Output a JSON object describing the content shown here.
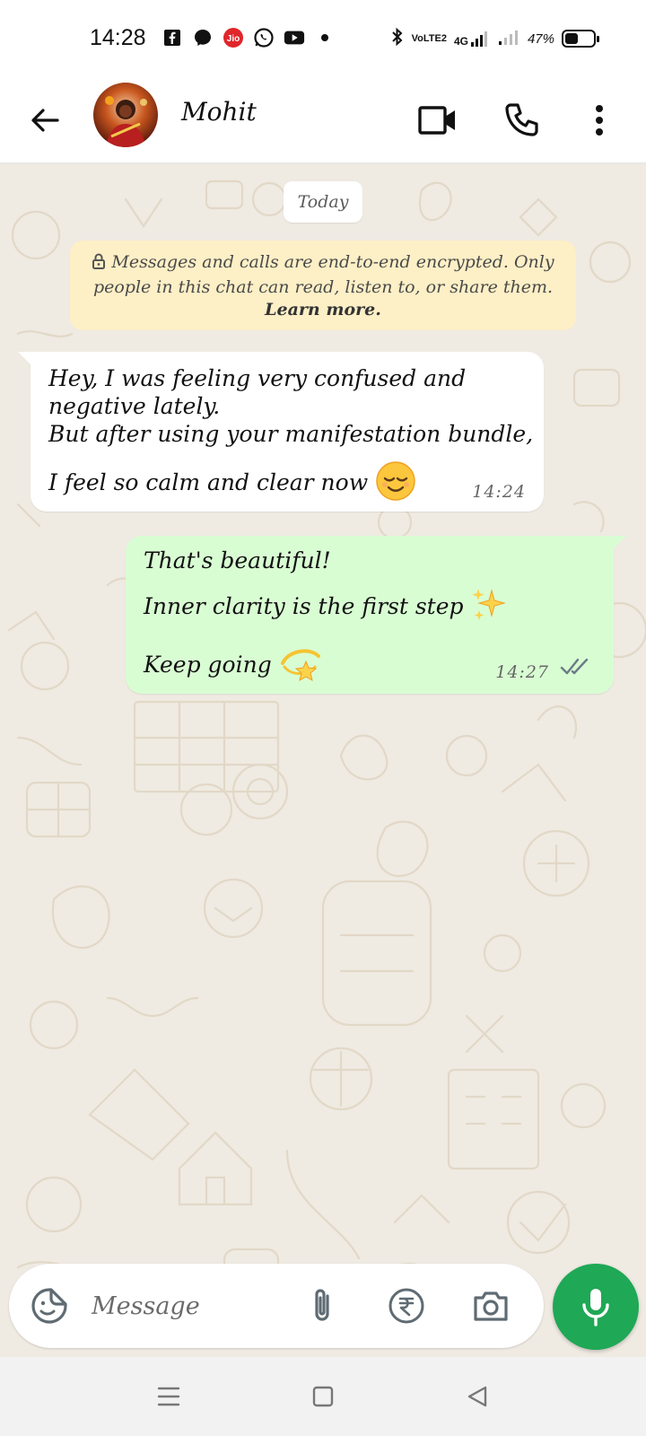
{
  "status_bar": {
    "time": "14:28",
    "left_icons": [
      "facebook-icon",
      "messenger-icon",
      "jio-icon",
      "whatsapp-icon",
      "youtube-icon",
      "dot-icon"
    ],
    "right_icons": [
      "bluetooth-icon",
      "volte-icon",
      "signal-4g-icon",
      "signal-icon"
    ],
    "volte_label": "VoLTE2",
    "network_label": "4G",
    "battery_text": "47%",
    "battery_level": 0.47,
    "jio_label": "Jio"
  },
  "header": {
    "contact_name": "Mohit",
    "back_icon": "arrow-left-icon",
    "video_call_icon": "video-camera-icon",
    "voice_call_icon": "phone-icon",
    "menu_icon": "more-vertical-icon"
  },
  "chat": {
    "date_label": "Today",
    "encryption_notice": {
      "line1": "Messages and calls are end-to-end encrypted. Only",
      "line2": "people in this chat can read, listen to, or share them.",
      "link": "Learn more."
    },
    "messages": [
      {
        "direction": "incoming",
        "lines": [
          "Hey, I was feeling very confused and",
          "negative lately.",
          "But after using your manifestation bundle,",
          "I feel so calm and clear now"
        ],
        "emoji": "😌",
        "time": "14:24"
      },
      {
        "direction": "outgoing",
        "lines": [
          "That's beautiful!",
          "Inner clarity is the first step",
          "Keep going"
        ],
        "emojis": [
          "✨",
          "💫"
        ],
        "time": "14:27",
        "status": "read"
      }
    ]
  },
  "composer": {
    "placeholder": "Message",
    "sticker_icon": "sticker-icon",
    "attach_icon": "paperclip-icon",
    "payment_icon": "rupee-icon",
    "camera_icon": "camera-icon",
    "mic_icon": "microphone-icon"
  },
  "colors": {
    "chat_background": "#efeae2",
    "incoming_bubble": "#ffffff",
    "outgoing_bubble": "#d9fdd3",
    "notice_background": "#fdefc6",
    "accent_green": "#1fa855",
    "read_tick": "#6b7b86"
  },
  "nav_bar": {
    "icons": [
      "menu-icon",
      "home-square-icon",
      "back-triangle-icon"
    ]
  }
}
